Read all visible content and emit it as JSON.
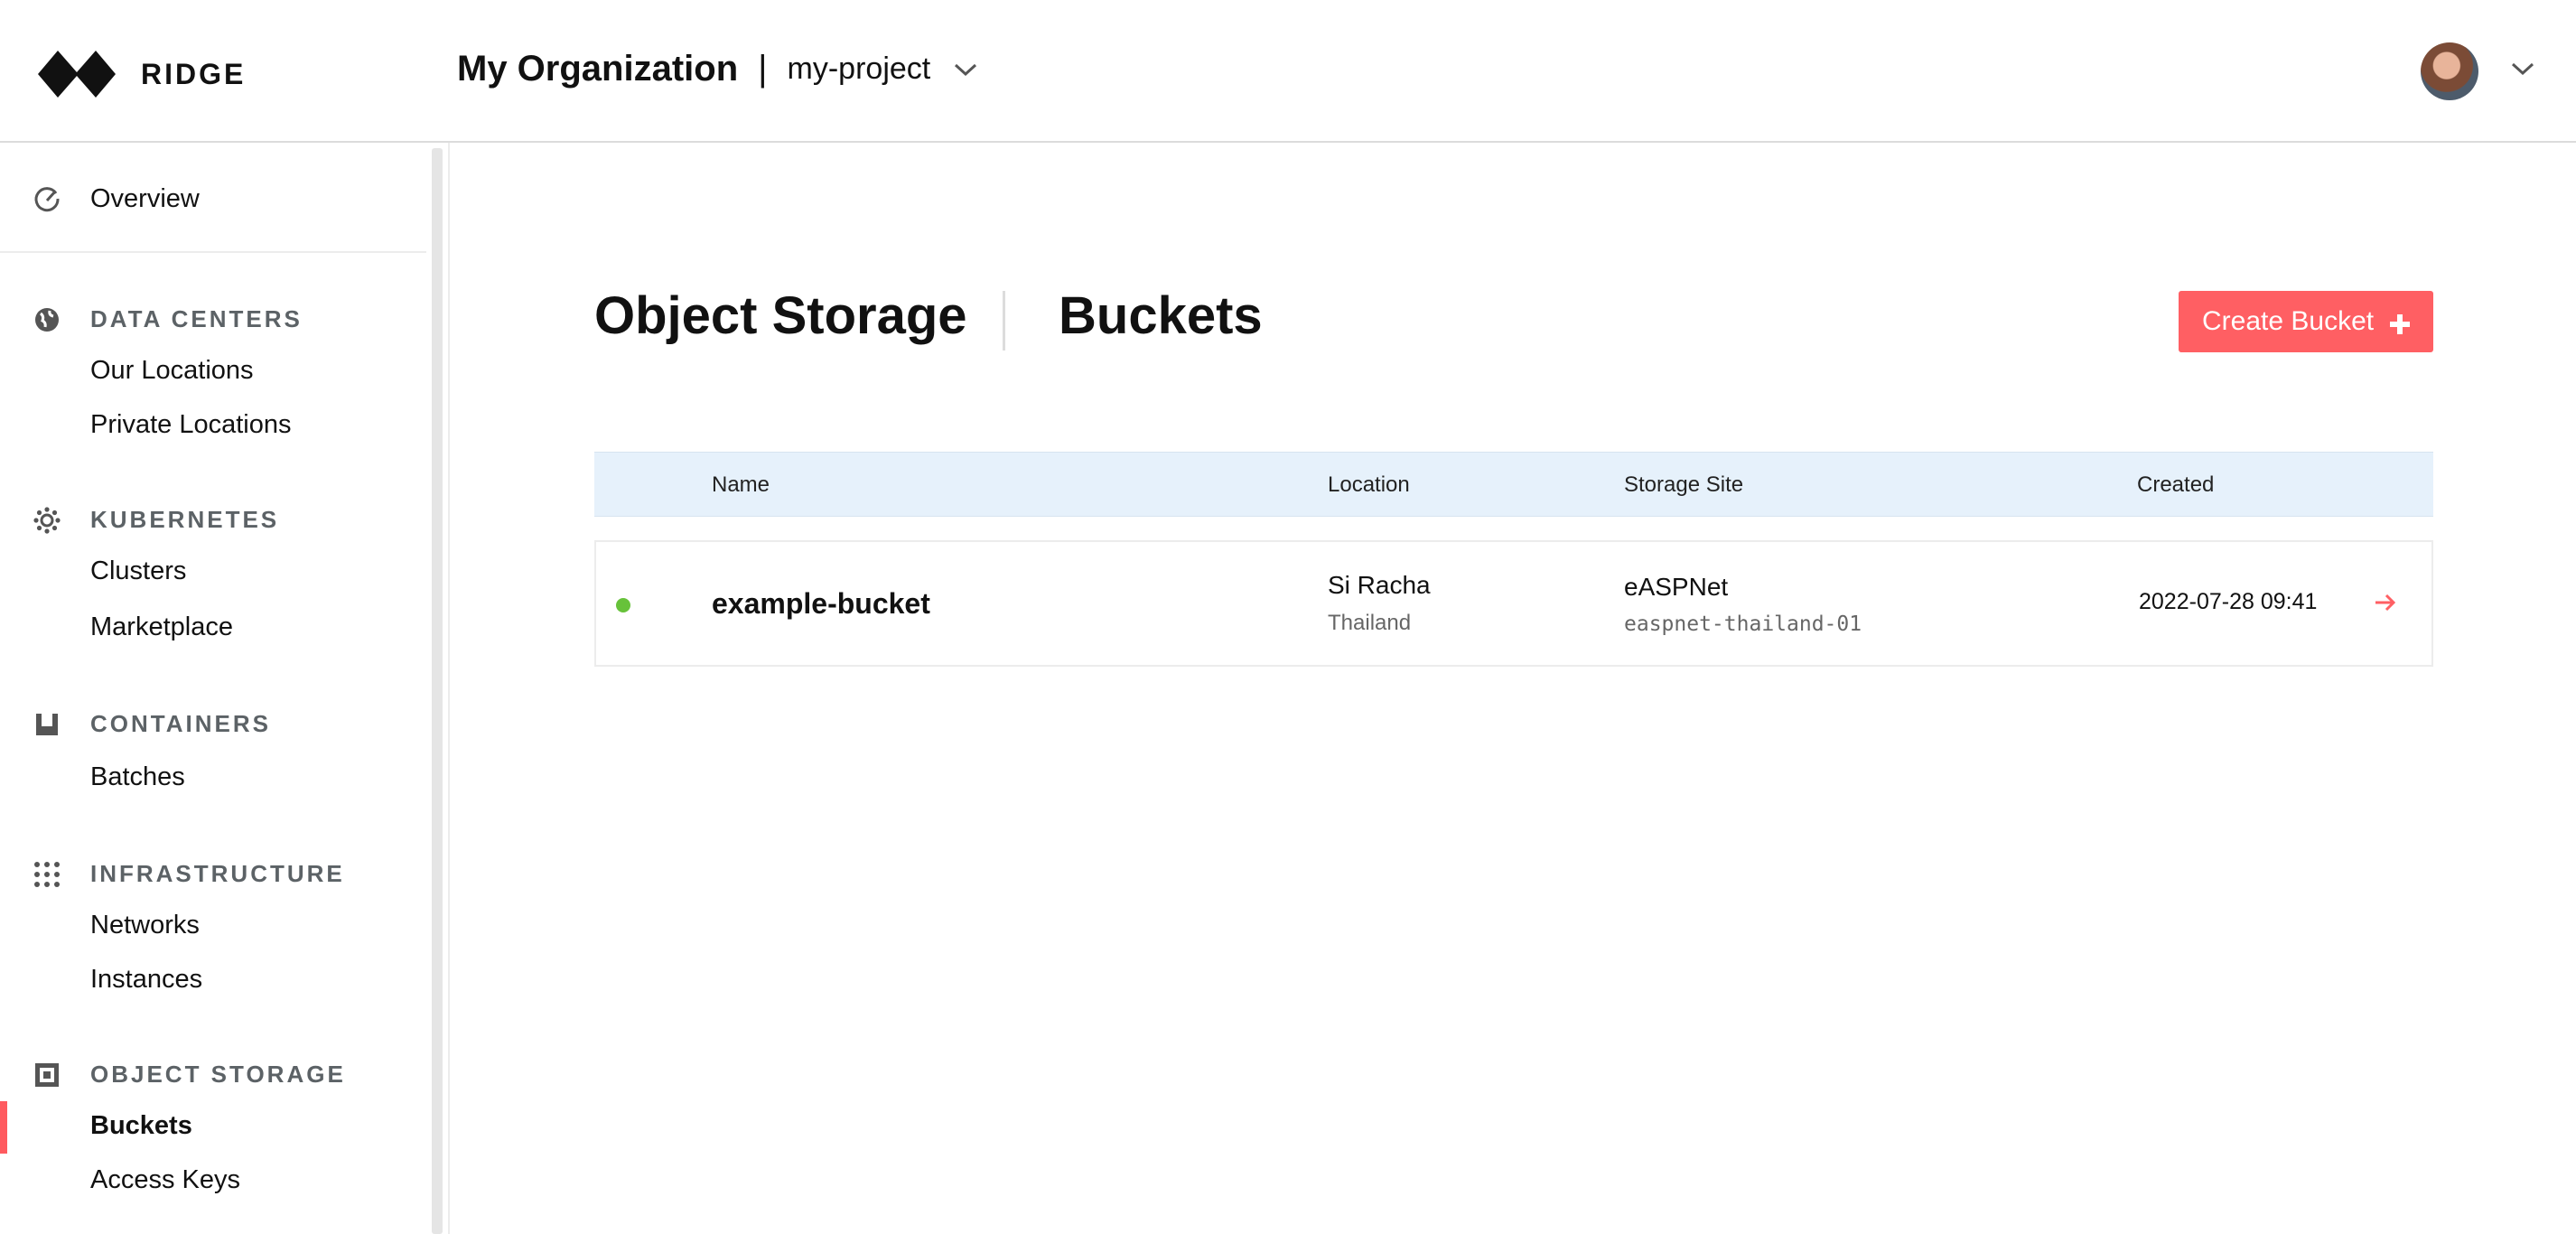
{
  "header": {
    "brand": "RIDGE",
    "organization": "My Organization",
    "separator": "|",
    "project": "my-project"
  },
  "sidebar": {
    "overview": "Overview",
    "sections": [
      {
        "title": "DATA CENTERS",
        "icon": "globe-icon",
        "items": [
          "Our Locations",
          "Private Locations"
        ]
      },
      {
        "title": "KUBERNETES",
        "icon": "kubernetes-icon",
        "items": [
          "Clusters",
          "Marketplace"
        ]
      },
      {
        "title": "CONTAINERS",
        "icon": "container-icon",
        "items": [
          "Batches"
        ]
      },
      {
        "title": "INFRASTRUCTURE",
        "icon": "grid-dots-icon",
        "items": [
          "Networks",
          "Instances"
        ]
      },
      {
        "title": "OBJECT STORAGE",
        "icon": "storage-icon",
        "items": [
          "Buckets",
          "Access Keys"
        ]
      }
    ],
    "active_item": "Buckets"
  },
  "main": {
    "title": "Object Storage",
    "subtitle": "Buckets",
    "create_button": "Create Bucket",
    "table": {
      "columns": [
        "Name",
        "Location",
        "Storage Site",
        "Created"
      ],
      "rows": [
        {
          "status": "active",
          "name": "example-bucket",
          "location_city": "Si Racha",
          "location_country": "Thailand",
          "storage_site": "eASPNet",
          "storage_site_id": "easpnet-thailand-01",
          "created": "2022-07-28 09:41"
        }
      ]
    }
  },
  "colors": {
    "accent": "#ff5f63",
    "status_ok": "#67c23a",
    "table_header_bg": "#e6f1fb"
  }
}
